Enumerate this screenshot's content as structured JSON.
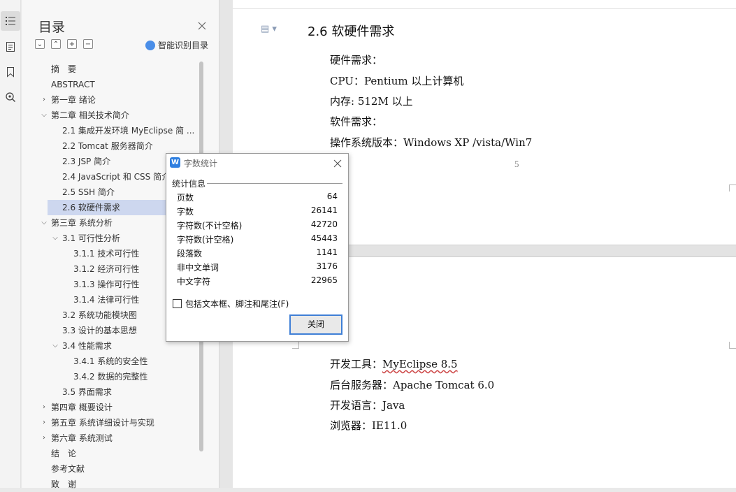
{
  "rail": {
    "icons": [
      "toc-icon",
      "document-icon",
      "bookmark-icon",
      "search-icon"
    ]
  },
  "toc": {
    "title": "目录",
    "smart_label": "智能识别目录",
    "items": [
      {
        "label": "摘　要",
        "level": 0,
        "arrow": ""
      },
      {
        "label": "ABSTRACT",
        "level": 0,
        "arrow": ""
      },
      {
        "label": "第一章  绪论",
        "level": 0,
        "arrow": "right"
      },
      {
        "label": "第二章  相关技术简介",
        "level": 0,
        "arrow": "down"
      },
      {
        "label": "2.1 集成开发环境 MyEclipse 简 ...",
        "level": 1,
        "arrow": ""
      },
      {
        "label": "2.2 Tomcat 服务器简介",
        "level": 1,
        "arrow": ""
      },
      {
        "label": "2.3 JSP 简介",
        "level": 1,
        "arrow": ""
      },
      {
        "label": "2.4 JavaScript 和 CSS 简介",
        "level": 1,
        "arrow": ""
      },
      {
        "label": "2.5 SSH 简介",
        "level": 1,
        "arrow": ""
      },
      {
        "label": "2.6 软硬件需求",
        "level": 1,
        "arrow": "",
        "selected": true
      },
      {
        "label": "第三章  系统分析",
        "level": 0,
        "arrow": "down"
      },
      {
        "label": "3.1 可行性分析",
        "level": 1,
        "arrow": "down"
      },
      {
        "label": "3.1.1 技术可行性",
        "level": 2,
        "arrow": ""
      },
      {
        "label": "3.1.2 经济可行性",
        "level": 2,
        "arrow": ""
      },
      {
        "label": "3.1.3 操作可行性",
        "level": 2,
        "arrow": ""
      },
      {
        "label": "3.1.4 法律可行性",
        "level": 2,
        "arrow": ""
      },
      {
        "label": "3.2 系统功能模块图",
        "level": 1,
        "arrow": ""
      },
      {
        "label": "3.3 设计的基本思想",
        "level": 1,
        "arrow": ""
      },
      {
        "label": "3.4 性能需求",
        "level": 1,
        "arrow": "down"
      },
      {
        "label": "3.4.1 系统的安全性",
        "level": 2,
        "arrow": ""
      },
      {
        "label": "3.4.2 数据的完整性",
        "level": 2,
        "arrow": ""
      },
      {
        "label": "3.5 界面需求",
        "level": 1,
        "arrow": ""
      },
      {
        "label": "第四章  概要设计",
        "level": 0,
        "arrow": "right"
      },
      {
        "label": "第五章  系统详细设计与实现",
        "level": 0,
        "arrow": "right"
      },
      {
        "label": "第六章  系统测试",
        "level": 0,
        "arrow": "right"
      },
      {
        "label": "结　论",
        "level": 0,
        "arrow": ""
      },
      {
        "label": "参考文献",
        "level": 0,
        "arrow": ""
      },
      {
        "label": "致　谢",
        "level": 0,
        "arrow": ""
      }
    ]
  },
  "document": {
    "heading": "2.6 软硬件需求",
    "page1_lines": [
      "硬件需求：",
      "CPU：Pentium 以上计算机",
      "内存: 512M 以上",
      "软件需求：",
      "操作系统版本：Windows XP /vista/Win7"
    ],
    "page_number": "5",
    "page2_lines": {
      "dev_tool_label": "开发工具：",
      "dev_tool_value": "MyEclipse 8.5",
      "server": "后台服务器：Apache Tomcat 6.0",
      "language": "开发语言：Java",
      "browser": "浏览器：IE11.0"
    }
  },
  "dialog": {
    "title": "字数统计",
    "logo": "W",
    "group_label": "统计信息",
    "stats": [
      {
        "label": "页数",
        "value": "64"
      },
      {
        "label": "字数",
        "value": "26141"
      },
      {
        "label": "字符数(不计空格)",
        "value": "42720"
      },
      {
        "label": "字符数(计空格)",
        "value": "45443"
      },
      {
        "label": "段落数",
        "value": "1141"
      },
      {
        "label": "非中文单词",
        "value": "3176"
      },
      {
        "label": "中文字符",
        "value": "22965"
      }
    ],
    "checkbox_label": "包括文本框、脚注和尾注(F)",
    "checkbox_checked": false,
    "close_button": "关闭"
  }
}
